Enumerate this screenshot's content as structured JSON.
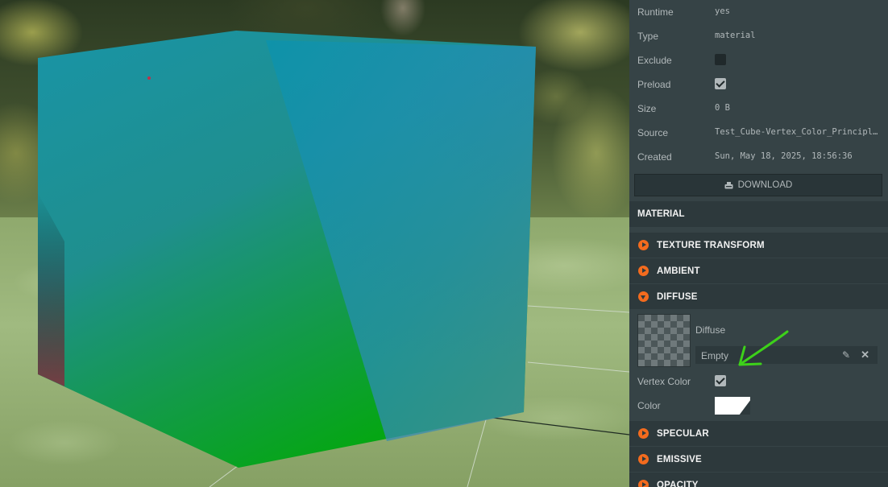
{
  "properties": [
    {
      "label": "Runtime",
      "value": "yes"
    },
    {
      "label": "Type",
      "value": "material"
    },
    {
      "label": "Exclude",
      "checked": false
    },
    {
      "label": "Preload",
      "checked": true
    },
    {
      "label": "Size",
      "value": "0 B"
    },
    {
      "label": "Source",
      "value": "Test_Cube-Vertex_Color_Principled_BSDF.glb"
    },
    {
      "label": "Created",
      "value": "Sun, May 18, 2025, 18:56:36"
    }
  ],
  "download": {
    "icon": "download-icon",
    "label": "DOWNLOAD"
  },
  "material": {
    "header": "MATERIAL"
  },
  "groups": {
    "texture_transform": "TEXTURE TRANSFORM",
    "ambient": "AMBIENT",
    "diffuse": "DIFFUSE",
    "specular": "SPECULAR",
    "emissive": "EMISSIVE",
    "opacity": "OPACITY"
  },
  "diffuse": {
    "texture_label": "Diffuse",
    "texture_value": "Empty",
    "vertex_color_label": "Vertex Color",
    "vertex_color_checked": true,
    "color_label": "Color",
    "color_value": "#ffffff"
  },
  "colors": {
    "accent": "#f36b1e",
    "panel": "#364346",
    "header": "#2d393c",
    "annotation_arrow": "#3dd11a"
  }
}
